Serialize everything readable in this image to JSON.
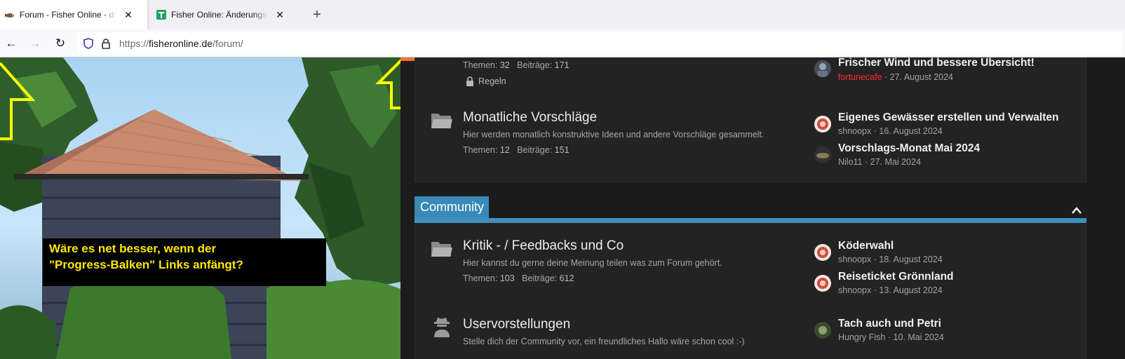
{
  "browser": {
    "tabs": [
      {
        "title": "Forum - Fisher Online - deutsch",
        "active": true,
        "icon": "fish-icon"
      },
      {
        "title": "Fisher Online: Änderungsvorsch",
        "active": false,
        "icon": "google-sheets-icon"
      }
    ],
    "new_tab": "+",
    "url": {
      "prefix": "https://",
      "domain": "fisheronline.de",
      "path": "/forum/"
    }
  },
  "annotation": {
    "line1": "Wäre es net besser, wenn der",
    "line2": "\"Progress-Balken\" Links anfängt?",
    "text_color": "#ffe800",
    "arrow_color": "#ffff00"
  },
  "top_node": {
    "stats_label_threads": "Themen:",
    "stats_threads": "32",
    "stats_label_posts": "Beiträge:",
    "stats_posts": "171",
    "rules_label": "Regeln",
    "last_post": {
      "title": "Frischer Wind und bessere Übersicht!",
      "user": "fortunecafe",
      "date": "27. August 2024"
    }
  },
  "nodes_section1": [
    {
      "title": "Monatliche Vorschläge",
      "description": "Hier werden monatlich konstruktive Ideen und andere Vorschläge gesammelt.",
      "threads_label": "Themen:",
      "threads": "12",
      "posts_label": "Beiträge:",
      "posts": "151",
      "last_posts": [
        {
          "title": "Eigenes Gewässer erstellen und Verwalten",
          "user": "shnoopx",
          "date": "16. August 2024"
        },
        {
          "title": "Vorschlags-Monat Mai 2024",
          "user": "Nilo11",
          "date": "27. Mai 2024"
        }
      ]
    }
  ],
  "category": {
    "title": "Community",
    "color": "#3a8ab8"
  },
  "nodes_section2": [
    {
      "title": "Kritik - / Feedbacks und Co",
      "description": "Hier kannst du gerne deine Meinung teilen was zum Forum gehört.",
      "threads_label": "Themen:",
      "threads": "103",
      "posts_label": "Beiträge:",
      "posts": "612",
      "last_posts": [
        {
          "title": "Köderwahl",
          "user": "shnoopx",
          "date": "18. August 2024"
        },
        {
          "title": "Reiseticket Grönnland",
          "user": "shnoopx",
          "date": "13. August 2024"
        }
      ]
    },
    {
      "title": "Uservorstellungen",
      "description": "Stelle dich der Community vor, ein freundliches Hallo wäre schon cool :-)",
      "last_posts": [
        {
          "title": "Tach auch und Petri",
          "user": "Hungry Fish",
          "date": "10. Mai 2024"
        }
      ]
    }
  ],
  "separator": " · ",
  "progress_bar_color": "#e8762e"
}
